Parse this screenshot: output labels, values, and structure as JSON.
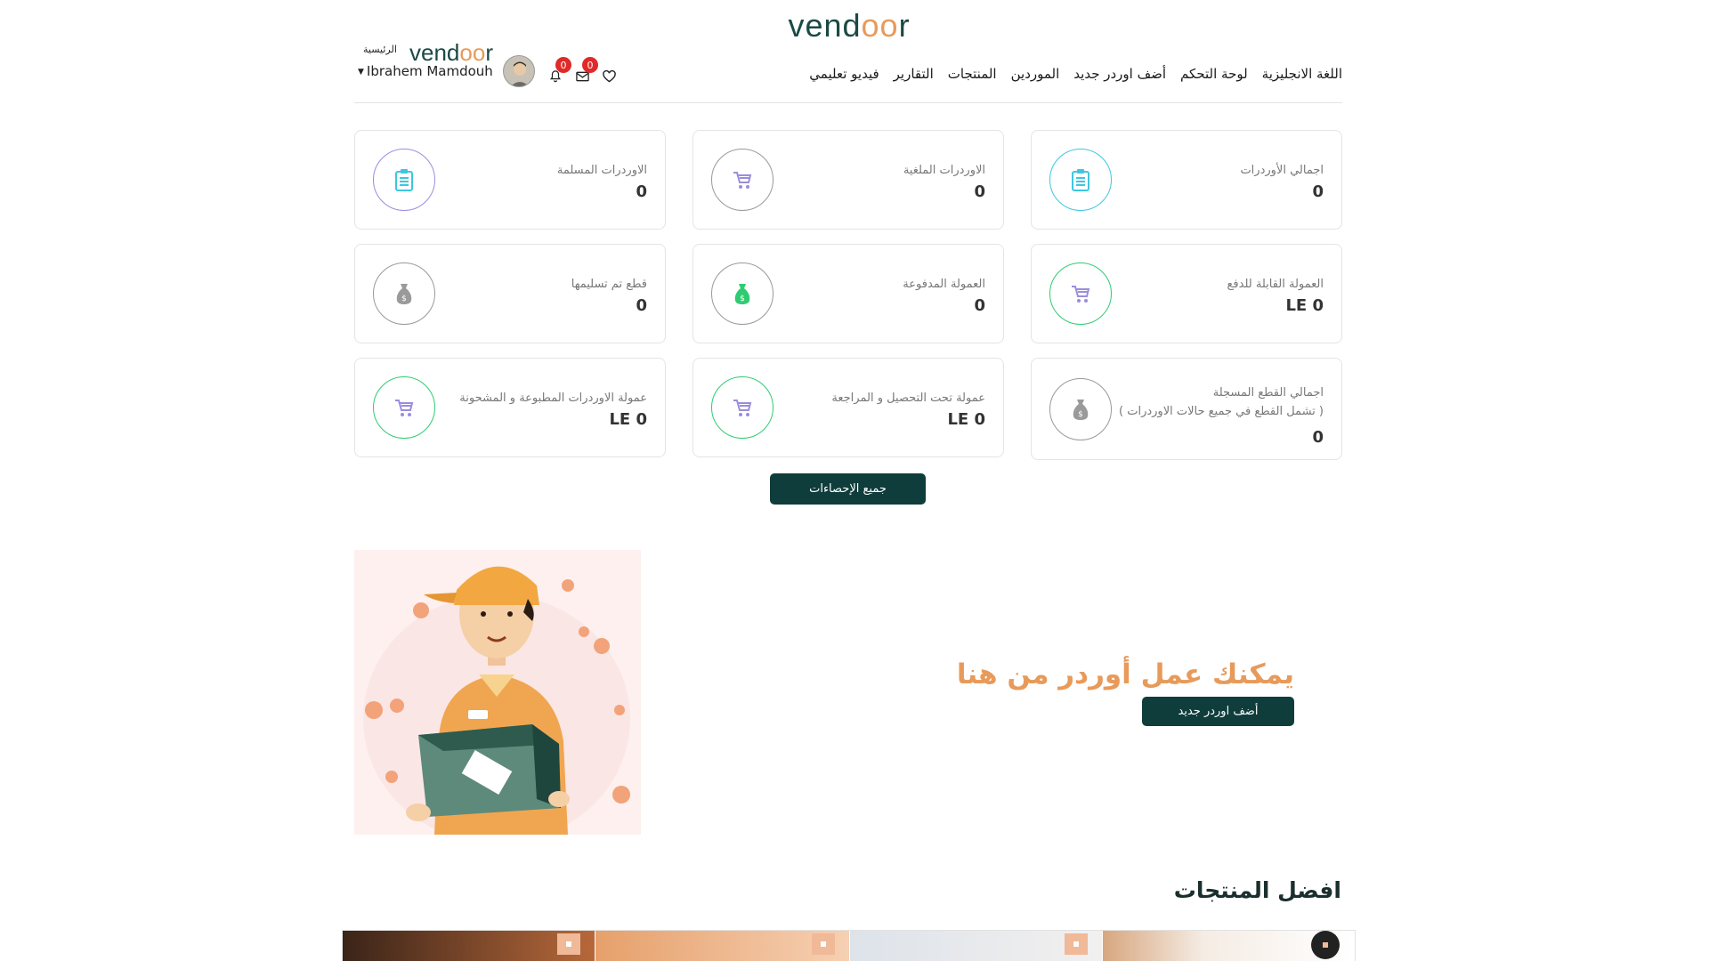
{
  "logo": {
    "text_main": "vend",
    "text_accent": "oo",
    "text_end": "r"
  },
  "header": {
    "home_label": "الرئيسية",
    "user_name": "Ibrahem Mamdouh",
    "messages_count": "0",
    "notifications_count": "0",
    "nav": [
      "اللغة الانجليزية",
      "لوحة التحكم",
      "أضف اوردر جديد",
      "الموردين",
      "المنتجات",
      "التقارير",
      "فيديو تعليمي"
    ]
  },
  "stats": [
    {
      "label": "اجمالي الأوردرات",
      "value": "0",
      "icon": "clipboard-icon",
      "color": "#3ec6e0"
    },
    {
      "label": "الاوردرات الملغية",
      "value": "0",
      "icon": "cart-icon",
      "color": "#9a8de0"
    },
    {
      "label": "الاوردرات المسلمة",
      "value": "0",
      "icon": "clipboard-icon",
      "color": "#3ec6e0"
    },
    {
      "label": "العمولة القابلة للدفع",
      "value": "LE 0",
      "icon": "cart-icon",
      "color": "#9a8de0"
    },
    {
      "label": "العمولة المدفوعة",
      "value": "0",
      "icon": "money-bag-icon",
      "color": "#2ecc71"
    },
    {
      "label": "قطع تم تسليمها",
      "value": "0",
      "icon": "money-bag-icon",
      "color": "#888888"
    },
    {
      "label": "اجمالي القطع المسجلة",
      "sublabel": "( تشمل القطع في جميع حالات الاوردرات )",
      "value": "0",
      "icon": "money-bag-icon",
      "color": "#888888"
    },
    {
      "label": "عمولة تحت التحصيل و المراجعة",
      "value": "LE 0",
      "icon": "cart-icon",
      "color": "#9a8de0"
    },
    {
      "label": "عمولة الاوردرات المطبوعة و المشحونة",
      "value": "LE 0",
      "icon": "cart-icon",
      "color": "#9a8de0"
    }
  ],
  "all_stats_button": "جميع الإحصاءات",
  "hero": {
    "title": "يمكنك عمل أوردر من هنا",
    "button": "أضف اوردر جديد"
  },
  "best_products": {
    "title": "افضل المنتجات"
  },
  "colors": {
    "brand_dark": "#0f3d3b",
    "accent": "#e89a5a"
  }
}
